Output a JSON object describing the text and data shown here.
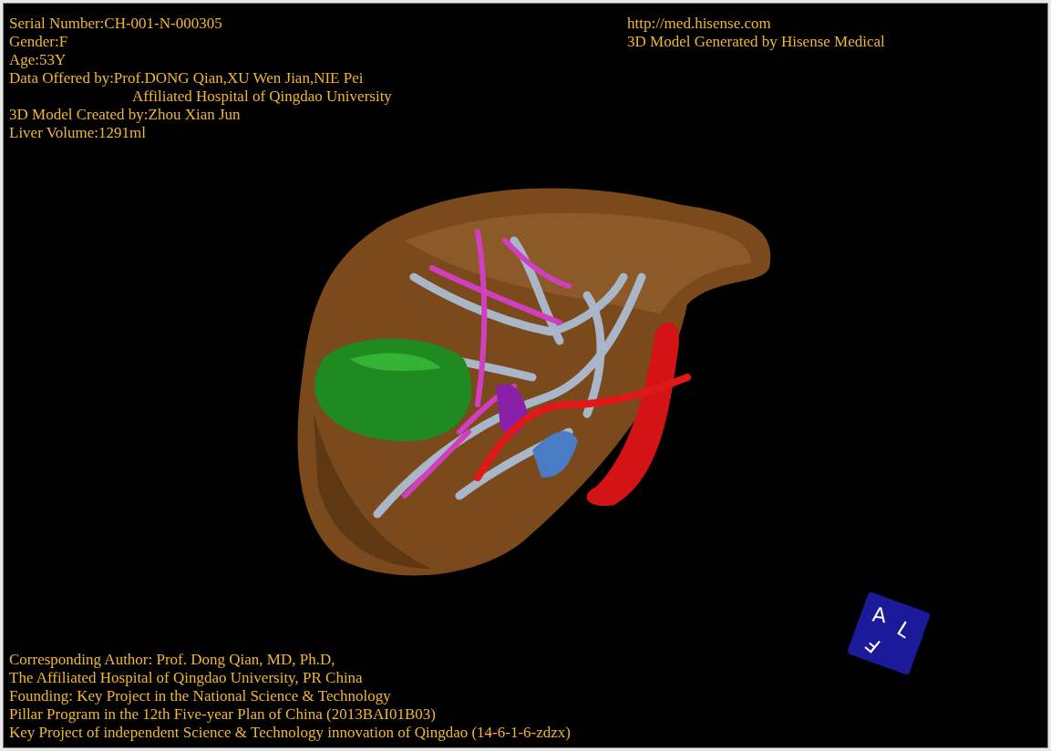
{
  "header_left": [
    {
      "text": "Serial Number:CH-001-N-000305",
      "indented": false
    },
    {
      "text": "Gender:F",
      "indented": false
    },
    {
      "text": "Age:53Y",
      "indented": false
    },
    {
      "text": "Data Offered by:Prof.DONG Qian,XU Wen Jian,NIE Pei",
      "indented": false
    },
    {
      "text": "Affiliated Hospital of Qingdao University",
      "indented": true
    },
    {
      "text": "3D Model Created by:Zhou Xian Jun",
      "indented": false
    },
    {
      "text": "Liver Volume:1291ml",
      "indented": false
    }
  ],
  "header_right": [
    "http://med.hisense.com",
    "3D Model Generated by Hisense Medical"
  ],
  "footer": [
    "Corresponding Author: Prof. Dong Qian, MD, Ph.D,",
    "The Affiliated Hospital of Qingdao University, PR China",
    "Founding: Key Project in the National Science & Technology",
    "Pillar Program in the 12th Five-year Plan of China (2013BAI01B03)",
    "Key Project of independent Science & Technology innovation of Qingdao (14-6-1-6-zdzx)"
  ],
  "orientation_cube": {
    "faces": [
      "A",
      "L",
      "F"
    ]
  }
}
